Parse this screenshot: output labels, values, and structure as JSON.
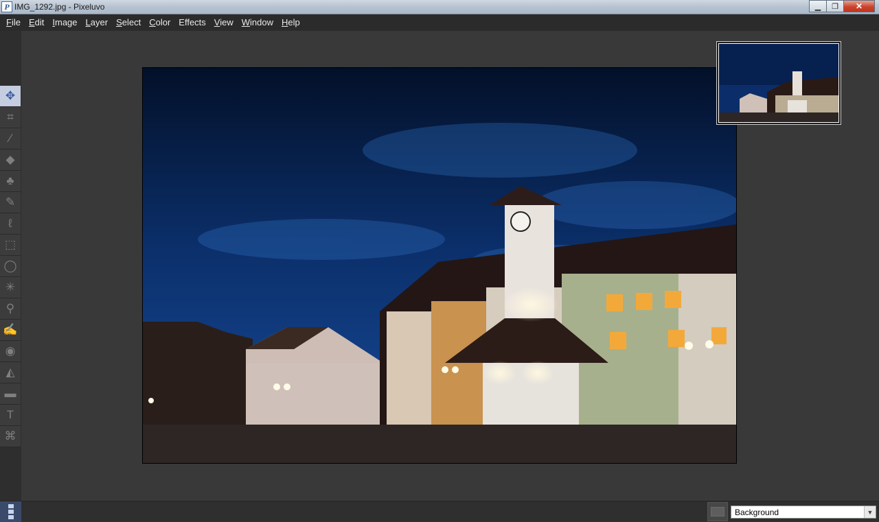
{
  "window": {
    "title": "IMG_1292.jpg - Pixeluvo",
    "app_icon": "P",
    "minimize_icon": "minimize-icon",
    "maximize_icon": "restore-icon",
    "close_icon": "close-icon"
  },
  "menu": {
    "items": [
      {
        "label": "File",
        "accel": "F",
        "rest": "ile"
      },
      {
        "label": "Edit",
        "accel": "E",
        "rest": "dit"
      },
      {
        "label": "Image",
        "accel": "I",
        "rest": "mage"
      },
      {
        "label": "Layer",
        "accel": "L",
        "rest": "ayer"
      },
      {
        "label": "Select",
        "accel": "S",
        "rest": "elect"
      },
      {
        "label": "Color",
        "accel": "C",
        "rest": "olor"
      },
      {
        "label": "Effects",
        "accel": "",
        "rest": "Effects"
      },
      {
        "label": "View",
        "accel": "V",
        "rest": "iew"
      },
      {
        "label": "Window",
        "accel": "W",
        "rest": "indow"
      },
      {
        "label": "Help",
        "accel": "H",
        "rest": "elp"
      }
    ]
  },
  "tools": [
    {
      "name": "move-tool",
      "icon": "move-icon",
      "glyph": "✥",
      "active": true
    },
    {
      "name": "crop-tool",
      "icon": "crop-icon",
      "glyph": "⌗",
      "active": false
    },
    {
      "name": "brush-tool",
      "icon": "brush-icon",
      "glyph": "⁄",
      "active": false
    },
    {
      "name": "eraser-tool",
      "icon": "eraser-icon",
      "glyph": "◆",
      "active": false
    },
    {
      "name": "clone-stamp-tool",
      "icon": "stamp-icon",
      "glyph": "♣",
      "active": false
    },
    {
      "name": "healing-brush-tool",
      "icon": "healing-brush-icon",
      "glyph": "✎",
      "active": false
    },
    {
      "name": "lasso-tool",
      "icon": "lasso-icon",
      "glyph": "ℓ",
      "active": false
    },
    {
      "name": "rectangle-select-tool",
      "icon": "rectangle-select-icon",
      "glyph": "⬚",
      "active": false
    },
    {
      "name": "ellipse-select-tool",
      "icon": "ellipse-select-icon",
      "glyph": "◯",
      "active": false
    },
    {
      "name": "magic-wand-tool",
      "icon": "magic-wand-icon",
      "glyph": "✳",
      "active": false
    },
    {
      "name": "dodge-burn-tool",
      "icon": "dodge-icon",
      "glyph": "⚲",
      "active": false
    },
    {
      "name": "smudge-tool",
      "icon": "smudge-icon",
      "glyph": "✍",
      "active": false
    },
    {
      "name": "red-eye-tool",
      "icon": "eye-icon",
      "glyph": "◉",
      "active": false
    },
    {
      "name": "paint-bucket-tool",
      "icon": "bucket-icon",
      "glyph": "◭",
      "active": false
    },
    {
      "name": "gradient-tool",
      "icon": "gradient-icon",
      "glyph": "▬",
      "active": false
    },
    {
      "name": "text-tool",
      "icon": "text-icon",
      "glyph": "T",
      "active": false
    },
    {
      "name": "perspective-tool",
      "icon": "perspective-icon",
      "glyph": "⌘",
      "active": false
    }
  ],
  "statusbar": {
    "panel_toggle_icon": "panel-toggle-icon",
    "layer_thumbnail_icon": "layer-thumbnail-icon",
    "layer_select_value": "Background",
    "dropdown_icon": "chevron-down-icon"
  },
  "colors": {
    "active_tool": "#c5cde0",
    "workspace": "#393939",
    "menubar": "#2b2b2b"
  }
}
